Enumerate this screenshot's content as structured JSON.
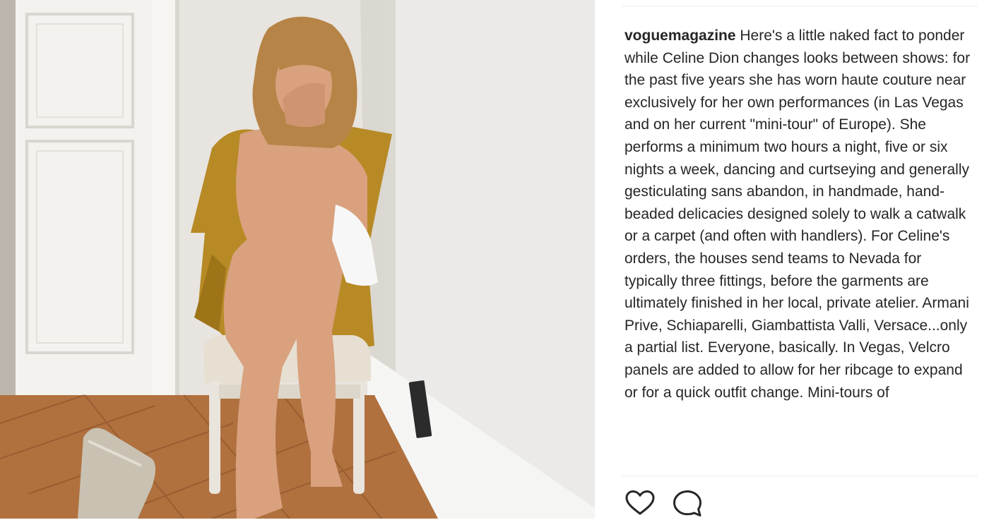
{
  "post": {
    "photo_alt": "Photo posted by voguemagazine",
    "username": "voguemagazine",
    "caption_text": " Here's a little naked fact to ponder while Celine Dion changes looks between shows: for the past five years she has worn haute couture near exclusively for her own performances (in Las Vegas and on her current \"mini-tour\" of Europe). She performs a minimum two hours a night, five or six nights a week, dancing and curtseying and generally gesticulating sans abandon, in handmade, hand-beaded delicacies designed solely to walk a catwalk or a carpet (and often with handlers). For Celine's orders, the houses send teams to Nevada for typically three fittings, before the garments are ultimately finished in her local, private atelier. Armani Prive, Schiaparelli, Giambattista Valli, Versace...only a partial list. Everyone, basically. In Vegas, Velcro panels are added to allow for her ribcage to expand or for a quick outfit change. Mini-tours of"
  },
  "actions": {
    "like_icon": "heart-outline-icon",
    "comment_icon": "speech-bubble-icon"
  },
  "colors": {
    "text": "#262626",
    "divider": "#ebebeb",
    "icon": "#262626"
  }
}
